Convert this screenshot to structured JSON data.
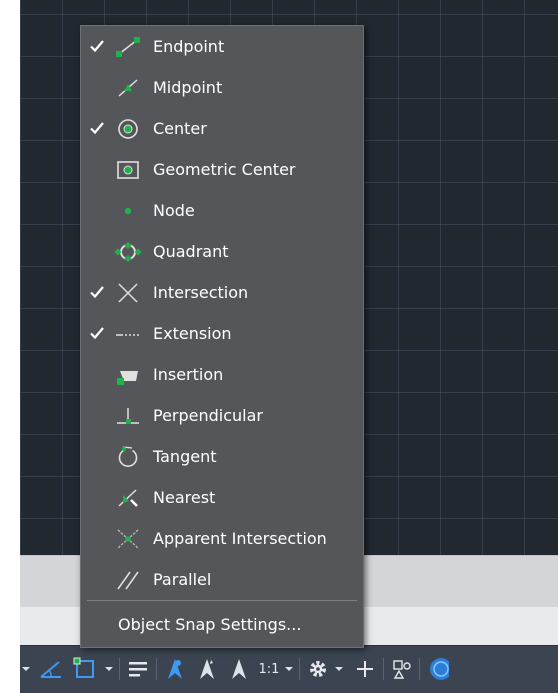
{
  "menu": {
    "items": [
      {
        "label": "Endpoint",
        "checked": true,
        "icon": "endpoint-icon"
      },
      {
        "label": "Midpoint",
        "checked": false,
        "icon": "midpoint-icon"
      },
      {
        "label": "Center",
        "checked": true,
        "icon": "center-icon"
      },
      {
        "label": "Geometric Center",
        "checked": false,
        "icon": "geometric-center-icon"
      },
      {
        "label": "Node",
        "checked": false,
        "icon": "node-icon"
      },
      {
        "label": "Quadrant",
        "checked": false,
        "icon": "quadrant-icon"
      },
      {
        "label": "Intersection",
        "checked": true,
        "icon": "intersection-icon"
      },
      {
        "label": "Extension",
        "checked": true,
        "icon": "extension-icon"
      },
      {
        "label": "Insertion",
        "checked": false,
        "icon": "insertion-icon"
      },
      {
        "label": "Perpendicular",
        "checked": false,
        "icon": "perpendicular-icon"
      },
      {
        "label": "Tangent",
        "checked": false,
        "icon": "tangent-icon"
      },
      {
        "label": "Nearest",
        "checked": false,
        "icon": "nearest-icon"
      },
      {
        "label": "Apparent Intersection",
        "checked": false,
        "icon": "apparent-intersection-icon"
      },
      {
        "label": "Parallel",
        "checked": false,
        "icon": "parallel-icon"
      }
    ],
    "settings_label": "Object Snap Settings..."
  },
  "status_bar": {
    "annotation_scale": "1:1"
  },
  "colors": {
    "menu_bg": "#545659",
    "snap_marker": "#21b24b",
    "status_bar_bg": "#3c4452",
    "active_toggle": "#3d9af2",
    "canvas_bg": "#212830"
  }
}
